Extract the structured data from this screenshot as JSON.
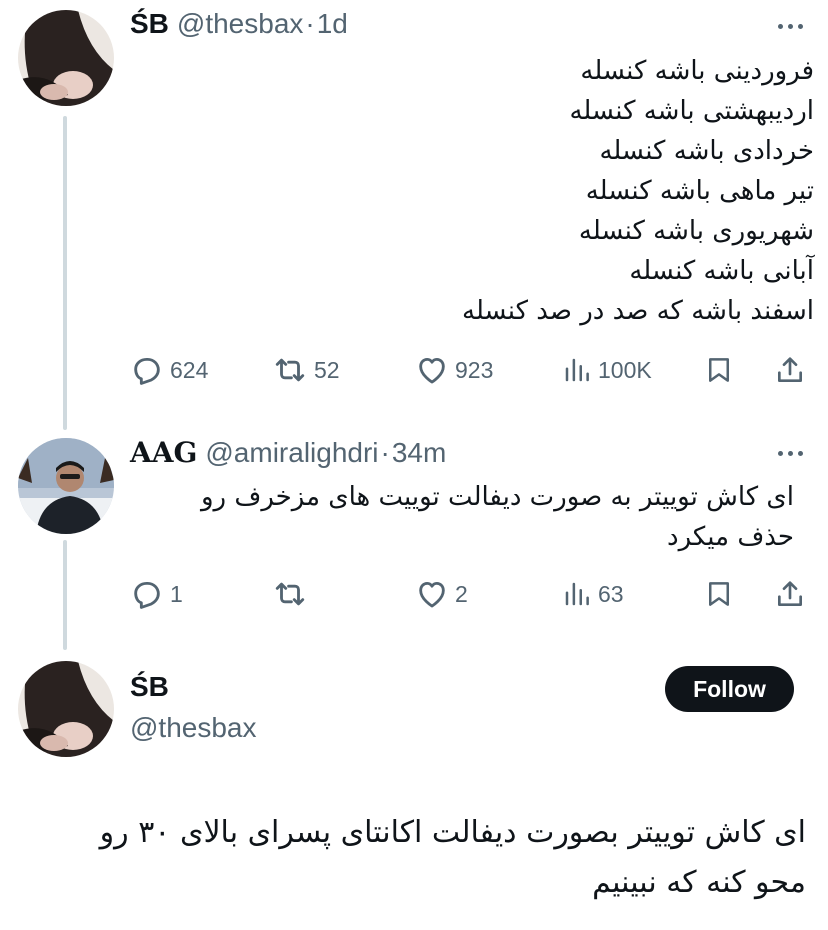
{
  "tweet1": {
    "display_name": "ŚB",
    "handle": "@thesbax",
    "separator": "·",
    "time": "1d",
    "lines": [
      "فروردینی باشه کنسله",
      "اردیبهشتی باشه کنسله",
      "خردادی باشه کنسله",
      "تیر ماهی باشه کنسله",
      "شهریوری باشه کنسله",
      "آبانی باشه کنسله",
      "اسفند باشه که صد در صد کنسله"
    ],
    "stats": {
      "replies": "624",
      "retweets": "52",
      "likes": "923",
      "views": "100K"
    }
  },
  "tweet2": {
    "display_name": "AAG",
    "handle": "@amiralighdri",
    "separator": "·",
    "time": "34m",
    "lines": [
      "ای کاش توییتر به صورت دیفالت توییت های مزخرف رو",
      "حذف میکرد"
    ],
    "stats": {
      "replies": "1",
      "retweets": "",
      "likes": "2",
      "views": "63"
    }
  },
  "main_tweet": {
    "display_name": "ŚB",
    "handle": "@thesbax",
    "follow_label": "Follow",
    "lines": [
      "ای کاش توییتر بصورت دیفالت اکانتای پسرای بالای ۳۰ رو",
      "محو کنه که نبینیم"
    ]
  },
  "colors": {
    "text": "#0f1419",
    "secondary": "#536471",
    "thread_line": "#cfd9de",
    "follow_bg": "#0f1419"
  },
  "icons": [
    "reply-icon",
    "retweet-icon",
    "like-icon",
    "views-icon",
    "bookmark-icon",
    "share-icon",
    "more-icon"
  ]
}
